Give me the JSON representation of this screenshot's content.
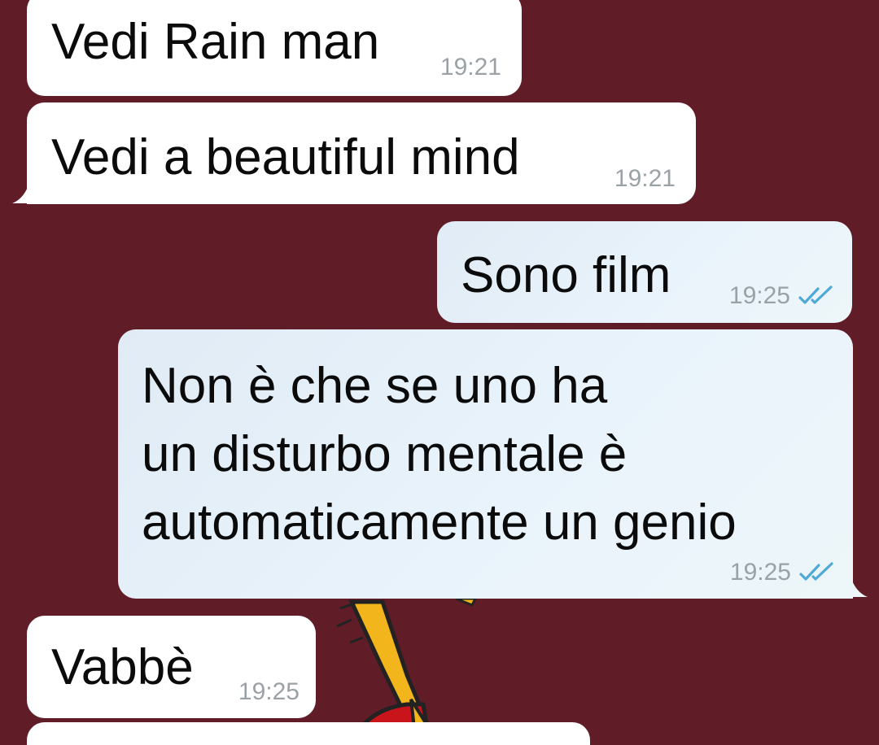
{
  "colors": {
    "background": "#611d27",
    "incoming_bubble": "#ffffff",
    "outgoing_bubble": "#e6f0f8",
    "timestamp": "#9aa2a6",
    "read_ticks": "#4fa9d6"
  },
  "messages": [
    {
      "direction": "in",
      "text": "Vedi Rain man",
      "time": "19:21"
    },
    {
      "direction": "in",
      "text": "Vedi a beautiful mind",
      "time": "19:21"
    },
    {
      "direction": "out",
      "text": "Sono film",
      "time": "19:25",
      "status_icon": "double-check-read-icon"
    },
    {
      "direction": "out",
      "text": "Non è che se uno ha\nun disturbo mentale è\nautomaticamente un genio",
      "time": "19:25",
      "status_icon": "double-check-read-icon"
    },
    {
      "direction": "in",
      "text": "Vabbè",
      "time": "19:25"
    }
  ]
}
